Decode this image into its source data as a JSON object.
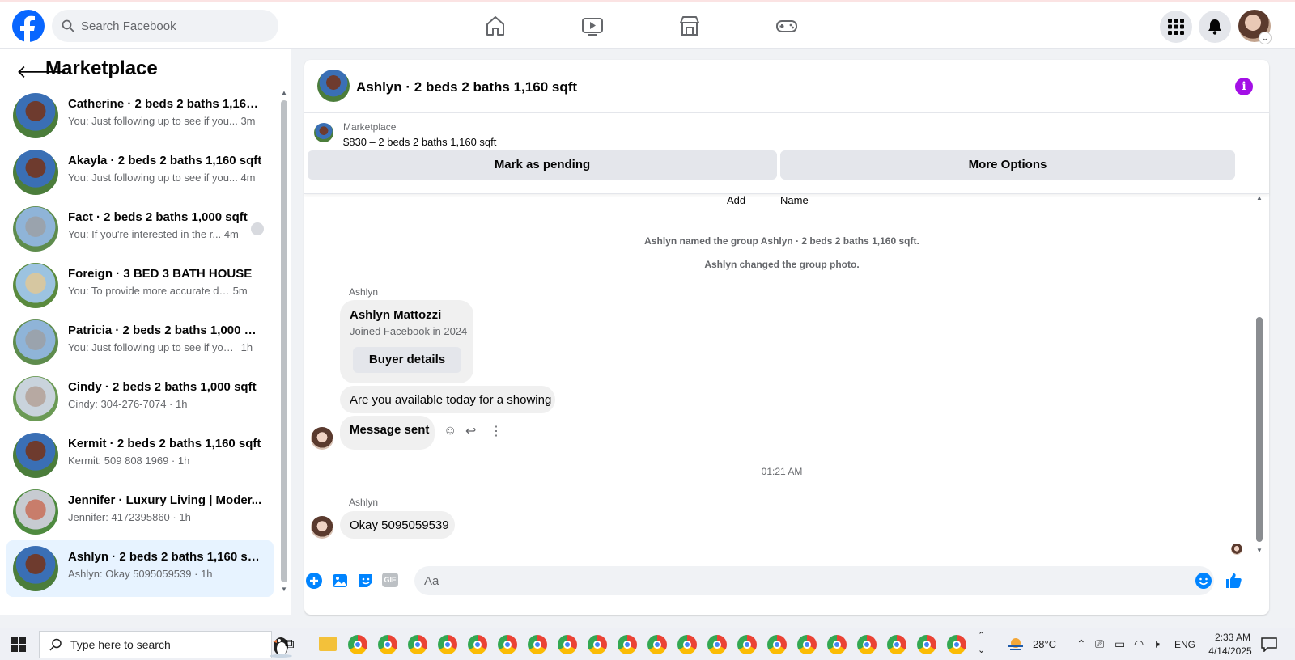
{
  "nav": {
    "search_placeholder": "Search Facebook",
    "brand_color": "#0866ff",
    "icons": [
      "home-icon",
      "watch-icon",
      "marketplace-icon",
      "gaming-icon"
    ],
    "right_icons": [
      "menu-grid-icon",
      "notifications-icon",
      "profile-avatar"
    ]
  },
  "sidebar": {
    "title": "Marketplace",
    "conversations": [
      {
        "title": "Catherine · 2 beds 2 baths 1,160 ...",
        "preview": "You: Just following up to see if you...",
        "time": "3m"
      },
      {
        "title": "Akayla · 2 beds 2 baths 1,160 sqft",
        "preview": "You: Just following up to see if you...",
        "time": "4m"
      },
      {
        "title": "Fact · 2 beds 2 baths 1,000 sqft",
        "preview": "You: If you're interested in the r...",
        "time": "4m"
      },
      {
        "title": "Foreign · 3 BED 3 BATH HOUSE",
        "preview": "You: To provide more accurate det...",
        "time": "5m"
      },
      {
        "title": "Patricia · 2 beds 2 baths 1,000 sqft",
        "preview": "You: Just following up to see if you'...",
        "time": "1h"
      },
      {
        "title": "Cindy · 2 beds 2 baths 1,000 sqft",
        "preview": "Cindy: 304-276-7074",
        "time": "1h"
      },
      {
        "title": "Kermit · 2 beds 2 baths 1,160 sqft",
        "preview": "Kermit: 509 808 1969",
        "time": "1h"
      },
      {
        "title": "Jennifer · Luxury Living | Moder...",
        "preview": "Jennifer: 4172395860",
        "time": "1h"
      },
      {
        "title": "Ashlyn · 2 beds 2 baths 1,160 sqft",
        "preview": "Ashlyn: Okay 5095059539",
        "time": "1h"
      }
    ]
  },
  "chat": {
    "title": "Ashlyn · 2 beds 2 baths 1,160 sqft",
    "info_color": "#a30fe6",
    "listing": {
      "category": "Marketplace",
      "price_line": "$830 – 2 beds 2 baths 1,160 sqft",
      "primary_action": "Mark as pending",
      "secondary_action": "More Options"
    },
    "columns": [
      "Add",
      "Name"
    ],
    "system_notes": [
      "Ashlyn named the group Ashlyn · 2 beds 2 baths 1,160 sqft.",
      "Ashlyn changed the group photo."
    ],
    "card": {
      "sender": "Ashlyn",
      "name": "Ashlyn Mattozzi",
      "subtitle": "Joined Facebook in 2024",
      "button": "Buyer details"
    },
    "question": "Are you available today for a showing",
    "sent_message": "Message sent",
    "timestamp": "01:21 AM",
    "last_sender": "Ashlyn",
    "last_message": "Okay 5095059539",
    "composer_placeholder": "Aa",
    "accent_color": "#0084ff"
  },
  "taskbar": {
    "search_placeholder": "Type here to search",
    "temperature": "28°C",
    "language": "ENG",
    "time": "2:33 AM",
    "date": "4/14/2025"
  }
}
